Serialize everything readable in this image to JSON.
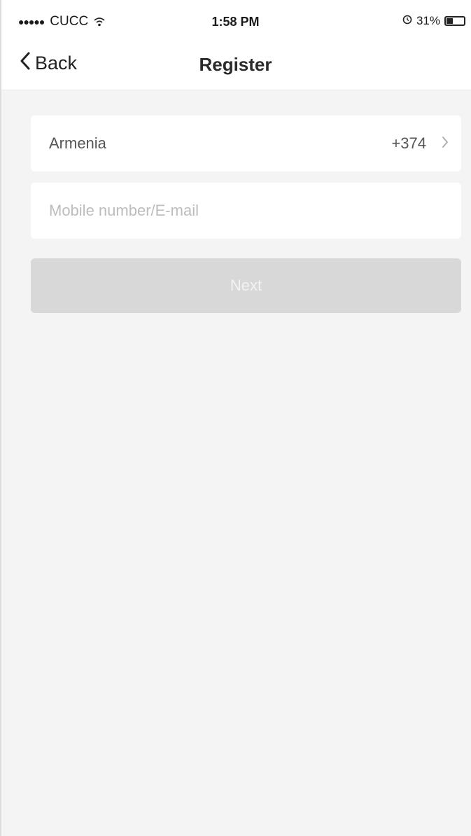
{
  "status_bar": {
    "signal": "●●●●●",
    "carrier": "CUCC",
    "time": "1:58 PM",
    "battery_percent": "31%",
    "icons": [
      "signal-dots-icon",
      "wifi-icon",
      "alarm-icon",
      "battery-icon"
    ]
  },
  "nav": {
    "back_label": "Back",
    "title": "Register"
  },
  "form": {
    "country_name": "Armenia",
    "country_code": "+374",
    "mobile_placeholder": "Mobile number/E-mail",
    "mobile_value": "",
    "next_label": "Next"
  },
  "colors": {
    "background": "#f4f4f4",
    "card": "#ffffff",
    "button_disabled": "#d8d8d8"
  }
}
